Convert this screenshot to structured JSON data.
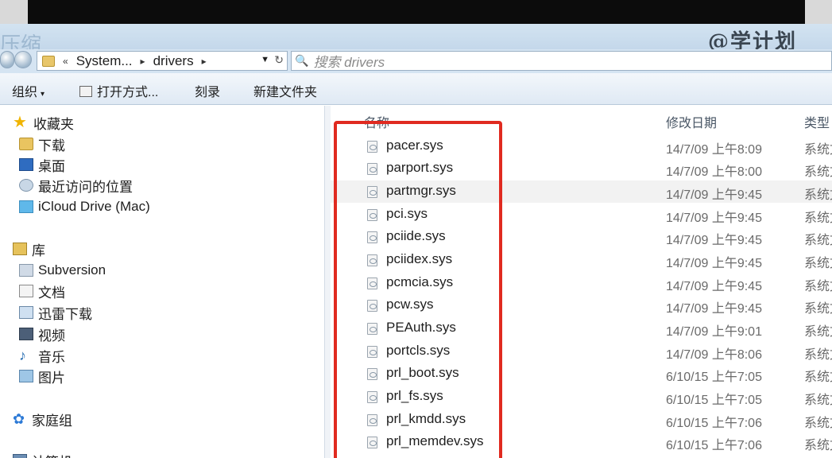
{
  "watermark": {
    "ghost_text": "压缩",
    "mark_text": "@学计划"
  },
  "address": {
    "crumbs": [
      "System...",
      "drivers"
    ],
    "search_placeholder": "搜索 drivers"
  },
  "toolbar": {
    "organize": "组织",
    "open_with": "打开方式...",
    "burn": "刻录",
    "new_folder": "新建文件夹"
  },
  "sidebar": {
    "favorites_header": "收藏夹",
    "favorites": [
      "下载",
      "桌面",
      "最近访问的位置",
      "iCloud Drive (Mac)"
    ],
    "libraries_header": "库",
    "libraries": [
      "Subversion",
      "文档",
      "迅雷下载",
      "视频",
      "音乐",
      "图片"
    ],
    "homegroup": "家庭组",
    "computer": "计算机"
  },
  "columns": {
    "name": "名称",
    "date": "修改日期",
    "type": "类型"
  },
  "files": [
    {
      "name": "pacer.sys",
      "date": "14/7/09 上午8:09",
      "type": "系统文件"
    },
    {
      "name": "parport.sys",
      "date": "14/7/09 上午8:00",
      "type": "系统文件"
    },
    {
      "name": "partmgr.sys",
      "date": "14/7/09 上午9:45",
      "type": "系统文件"
    },
    {
      "name": "pci.sys",
      "date": "14/7/09 上午9:45",
      "type": "系统文件"
    },
    {
      "name": "pciide.sys",
      "date": "14/7/09 上午9:45",
      "type": "系统文件"
    },
    {
      "name": "pciidex.sys",
      "date": "14/7/09 上午9:45",
      "type": "系统文件"
    },
    {
      "name": "pcmcia.sys",
      "date": "14/7/09 上午9:45",
      "type": "系统文件"
    },
    {
      "name": "pcw.sys",
      "date": "14/7/09 上午9:45",
      "type": "系统文件"
    },
    {
      "name": "PEAuth.sys",
      "date": "14/7/09 上午9:01",
      "type": "系统文件"
    },
    {
      "name": "portcls.sys",
      "date": "14/7/09 上午8:06",
      "type": "系统文件"
    },
    {
      "name": "prl_boot.sys",
      "date": "6/10/15 上午7:05",
      "type": "系统文件"
    },
    {
      "name": "prl_fs.sys",
      "date": "6/10/15 上午7:05",
      "type": "系统文件"
    },
    {
      "name": "prl_kmdd.sys",
      "date": "6/10/15 上午7:06",
      "type": "系统文件"
    },
    {
      "name": "prl_memdev.sys",
      "date": "6/10/15 上午7:06",
      "type": "系统文件"
    }
  ],
  "colors": {
    "highlight_box": "#e02a20",
    "toolbar_bg": "#dfe9f4",
    "hover_row": "#f2f2f2"
  }
}
